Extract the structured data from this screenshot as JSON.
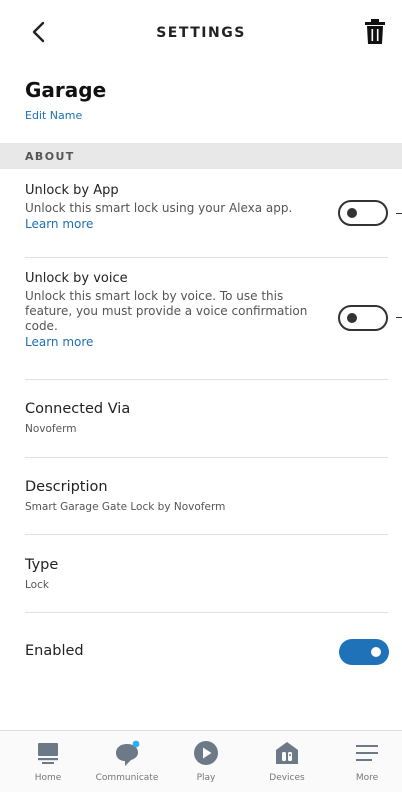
{
  "header": {
    "title": "SETTINGS"
  },
  "device": {
    "name": "Garage",
    "edit_label": "Edit Name"
  },
  "section": {
    "label": "ABOUT"
  },
  "unlock_app": {
    "title": "Unlock by App",
    "description": "Unlock this smart lock using your Alexa app.",
    "link": "Learn more",
    "enabled": false
  },
  "unlock_voice": {
    "title": "Unlock by voice",
    "description": "Unlock this smart lock by voice. To use this feature, you must provide a voice confirmation code.",
    "link": "Learn more",
    "enabled": false
  },
  "connected": {
    "title": "Connected Via",
    "value": "Novoferm"
  },
  "description": {
    "title": "Description",
    "value": "Smart Garage Gate Lock by Novoferm"
  },
  "type": {
    "title": "Type",
    "value": "Lock"
  },
  "enabled": {
    "title": "Enabled",
    "enabled": true
  },
  "colors": {
    "accent": "#1f72b8",
    "link": "#1f6fb2",
    "notification_dot": "#2ab0f0"
  },
  "nav": {
    "items": [
      {
        "label": "Home",
        "icon": "home-icon"
      },
      {
        "label": "Communicate",
        "icon": "chat-bubble-icon"
      },
      {
        "label": "Play",
        "icon": "play-icon"
      },
      {
        "label": "Devices",
        "icon": "devices-icon"
      },
      {
        "label": "More",
        "icon": "menu-icon"
      }
    ]
  }
}
